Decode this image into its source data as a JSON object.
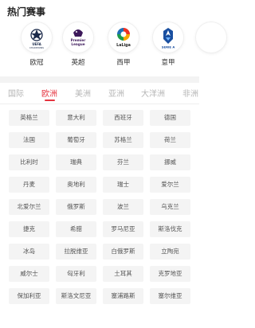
{
  "hot_section": {
    "title": "热门赛事"
  },
  "leagues": [
    {
      "name": "欧冠",
      "logo_text": "UEFA",
      "logo_sub": "CHAMPIONS",
      "icon": "champions-league-icon"
    },
    {
      "name": "英超",
      "logo_text": "Premier",
      "logo_sub": "League",
      "icon": "premier-league-icon"
    },
    {
      "name": "西甲",
      "logo_text": "LaLiga",
      "logo_sub": "",
      "icon": "laliga-icon"
    },
    {
      "name": "意甲",
      "logo_text": "SERIE A",
      "logo_sub": "",
      "icon": "serie-a-icon"
    }
  ],
  "tabs": [
    "国际",
    "欧洲",
    "美洲",
    "亚洲",
    "大洋洲",
    "非洲"
  ],
  "active_tab": "欧洲",
  "accent_color": "#e5343f",
  "countries": [
    "英格兰",
    "意大利",
    "西班牙",
    "德国",
    "法国",
    "葡萄牙",
    "苏格兰",
    "荷兰",
    "比利时",
    "瑞典",
    "芬兰",
    "挪威",
    "丹麦",
    "奥地利",
    "瑞士",
    "爱尔兰",
    "北爱尔兰",
    "俄罗斯",
    "波兰",
    "乌克兰",
    "捷克",
    "希腊",
    "罗马尼亚",
    "斯洛伐克",
    "冰岛",
    "拉脱维亚",
    "白俄罗斯",
    "立陶宛",
    "威尔士",
    "匈牙利",
    "土耳其",
    "克罗地亚",
    "保加利亚",
    "斯洛文尼亚",
    "塞浦路斯",
    "塞尔维亚"
  ]
}
